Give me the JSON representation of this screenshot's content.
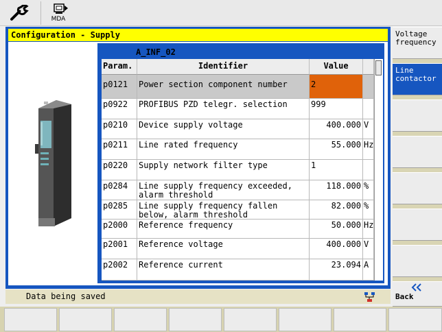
{
  "toolbar": {
    "wrench_icon": "wrench-icon",
    "mda_icon": "mda-icon",
    "mda_label": "MDA"
  },
  "window": {
    "title": "Configuration - Supply"
  },
  "table": {
    "title": "A_INF_02",
    "headers": {
      "param": "Param.",
      "identifier": "Identifier",
      "value": "Value"
    },
    "rows": [
      {
        "param": "p0121",
        "identifier": "Power section component number",
        "value": "2",
        "unit": ""
      },
      {
        "param": "p0922",
        "identifier": "PROFIBUS PZD telegr. selection",
        "value": "999",
        "unit": ""
      },
      {
        "param": "p0210",
        "identifier": "Device supply voltage",
        "value": "400.000",
        "unit": "V"
      },
      {
        "param": "p0211",
        "identifier": "Line rated frequency",
        "value": "55.000",
        "unit": "Hz"
      },
      {
        "param": "p0220",
        "identifier": "Supply network filter type",
        "value": "1",
        "unit": ""
      },
      {
        "param": "p0284",
        "identifier": "Line supply frequency exceeded, alarm threshold",
        "value": "118.000",
        "unit": "%"
      },
      {
        "param": "p0285",
        "identifier": "Line supply frequency fallen below, alarm threshold",
        "value": "82.000",
        "unit": "%"
      },
      {
        "param": "p2000",
        "identifier": "Reference frequency",
        "value": "50.000",
        "unit": "Hz"
      },
      {
        "param": "p2001",
        "identifier": "Reference voltage",
        "value": "400.000",
        "unit": "V"
      },
      {
        "param": "p2002",
        "identifier": "Reference current",
        "value": "23.094",
        "unit": "A"
      }
    ],
    "selected_color": "#e0620a"
  },
  "softkeys_right": {
    "sk1": "Voltage\nfrequency",
    "sk2": "Line\ncontactor",
    "sk8": "Back",
    "back_icon": "double-chevron-left-icon"
  },
  "status": {
    "text": "Data being saved",
    "icon": "network-status-icon"
  },
  "colors": {
    "frame_blue": "#1656c0",
    "title_yellow": "#ffff00",
    "status_beige": "#e6e2c5"
  }
}
